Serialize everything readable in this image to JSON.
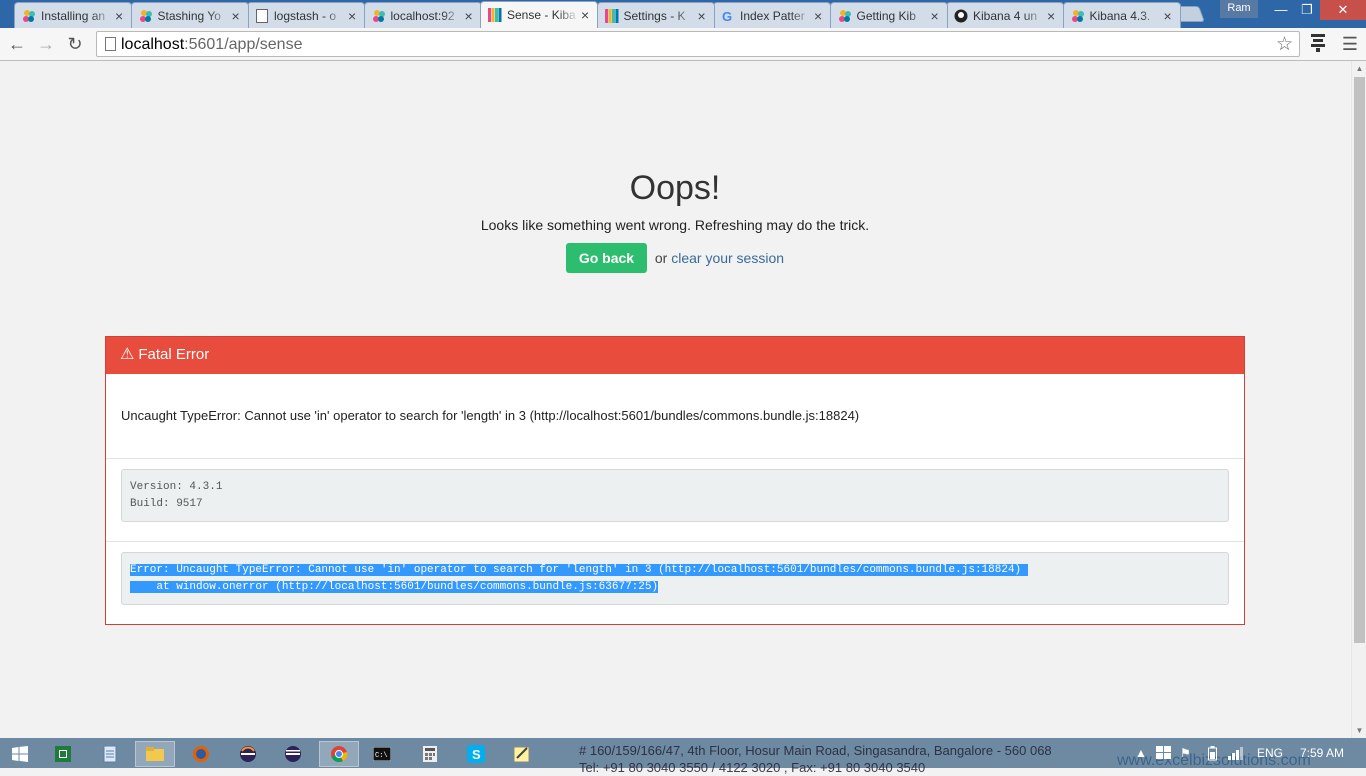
{
  "browser": {
    "tabs": [
      {
        "title": "Installing an",
        "icon": "elastic-icon"
      },
      {
        "title": "Stashing Yo",
        "icon": "elastic-icon"
      },
      {
        "title": "logstash - o",
        "icon": "page-icon"
      },
      {
        "title": "localhost:92",
        "icon": "elastic-icon"
      },
      {
        "title": "Sense - Kiba",
        "icon": "kibana-icon",
        "active": true
      },
      {
        "title": "Settings - K",
        "icon": "kibana-icon"
      },
      {
        "title": "Index Patter",
        "icon": "google-icon"
      },
      {
        "title": "Getting Kib",
        "icon": "elastic-icon"
      },
      {
        "title": "Kibana 4 un",
        "icon": "github-icon"
      },
      {
        "title": "Kibana 4.3.",
        "icon": "elastic-icon"
      }
    ],
    "user_label": "Ram",
    "url_host": "localhost",
    "url_rest": ":5601/app/sense"
  },
  "page": {
    "heading": "Oops!",
    "lead": "Looks like something went wrong. Refreshing may do the trick.",
    "go_back_label": "Go back",
    "or_text": "or",
    "clear_session_label": "clear your session",
    "fatal": {
      "title": "Fatal Error",
      "message": "Uncaught TypeError: Cannot use 'in' operator to search for 'length' in 3 (http://localhost:5601/bundles/commons.bundle.js:18824)",
      "version_line": "Version: 4.3.1",
      "build_line": "Build: 9517",
      "stack_line1": "Error: Uncaught TypeError: Cannot use 'in' operator to search for 'length' in 3 (http://localhost:5601/bundles/commons.bundle.js:18824) ",
      "stack_line2": "    at window.onerror (http://localhost:5601/bundles/commons.bundle.js:63677:25)"
    }
  },
  "overlay": {
    "address_line1": "# 160/159/166/47, 4th Floor, Hosur Main Road, Singasandra, Bangalore - 560 068",
    "address_line2": "Tel: +91 80 3040 3550 / 4122 3020 , Fax: +91 80 3040 3540",
    "website": "www.excelbizsolutions.com"
  },
  "taskbar": {
    "apps": [
      "windows-start-icon",
      "excel-icon",
      "notepad-icon",
      "file-explorer-icon",
      "firefox-icon",
      "eclipse-icon",
      "eclipse-icon",
      "chrome-icon",
      "cmd-icon",
      "calculator-icon",
      "skype-icon",
      "notes-icon"
    ],
    "language": "ENG",
    "time": "7:59 AM"
  }
}
